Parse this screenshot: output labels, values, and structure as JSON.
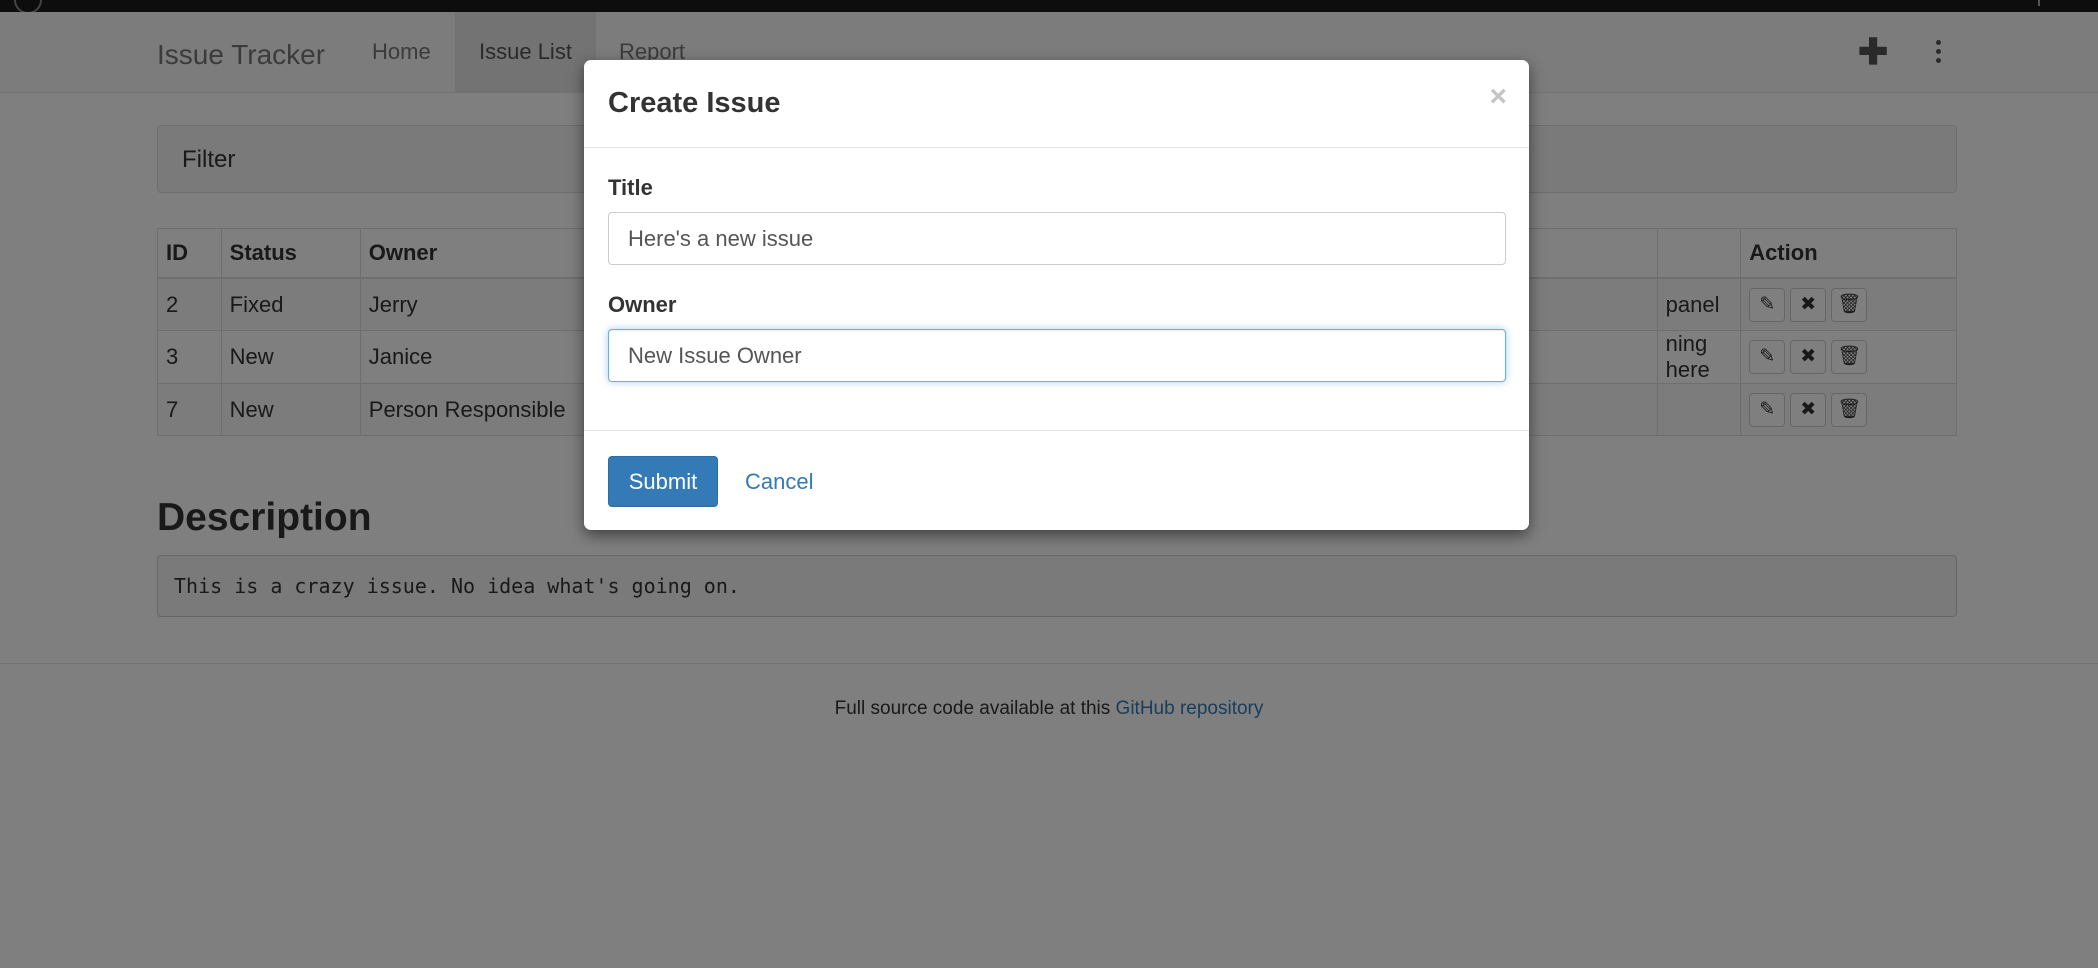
{
  "navbar": {
    "brand": "Issue Tracker",
    "links": [
      "Home",
      "Issue List",
      "Report"
    ],
    "active": "Issue List",
    "add_icon": "plus-icon",
    "menu_icon": "vertical-ellipsis-icon"
  },
  "filter": {
    "label": "Filter"
  },
  "table": {
    "headers": {
      "id": "ID",
      "status": "Status",
      "owner": "Owner",
      "action": "Action"
    },
    "rows": [
      {
        "id": "2",
        "status": "Fixed",
        "owner": "Jerry",
        "title_fragment": "panel"
      },
      {
        "id": "3",
        "status": "New",
        "owner": "Janice",
        "title_fragment": "ning here"
      },
      {
        "id": "7",
        "status": "New",
        "owner": "Person Responsible",
        "title_fragment": ""
      }
    ],
    "action_icons": [
      "edit-icon",
      "close-icon",
      "trash-icon"
    ]
  },
  "description": {
    "heading": "Description",
    "text": "This is a crazy issue. No idea what's going on."
  },
  "footer": {
    "text": "Full source code available at this",
    "link": "GitHub repository"
  },
  "modal": {
    "title": "Create Issue",
    "close_glyph": "×",
    "title_label": "Title",
    "title_value": "Here's a new issue",
    "owner_label": "Owner",
    "owner_value": "New Issue Owner",
    "submit_label": "Submit",
    "cancel_label": "Cancel"
  },
  "colors": {
    "primary": "#337ab7",
    "focus": "#66afe9",
    "overlay": "rgba(0,0,0,0.5)"
  }
}
